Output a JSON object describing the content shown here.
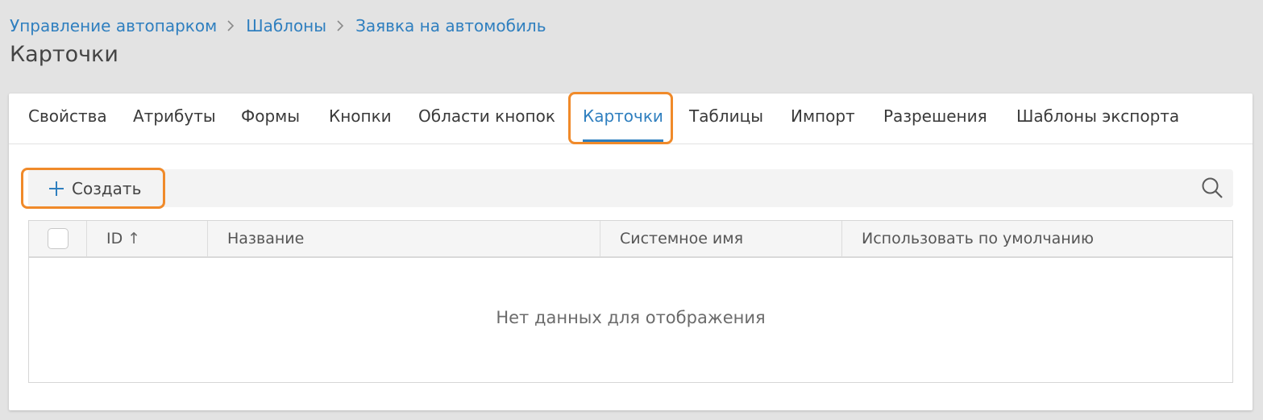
{
  "breadcrumb": {
    "items": [
      {
        "label": "Управление автопарком"
      },
      {
        "label": "Шаблоны"
      },
      {
        "label": "Заявка на автомобиль"
      }
    ]
  },
  "page": {
    "title": "Карточки"
  },
  "tabs": {
    "items": [
      {
        "label": "Свойства"
      },
      {
        "label": "Атрибуты"
      },
      {
        "label": "Формы"
      },
      {
        "label": "Кнопки"
      },
      {
        "label": "Области кнопок"
      },
      {
        "label": "Карточки"
      },
      {
        "label": "Таблицы"
      },
      {
        "label": "Импорт"
      },
      {
        "label": "Разрешения"
      },
      {
        "label": "Шаблоны экспорта"
      }
    ],
    "active": "Карточки"
  },
  "toolbar": {
    "create_label": "Создать",
    "create_icon": "plus-icon",
    "search_icon": "search-icon"
  },
  "table": {
    "columns": [
      {
        "label": "ID",
        "sort": "↑"
      },
      {
        "label": "Название"
      },
      {
        "label": "Системное имя"
      },
      {
        "label": "Использовать по умолчанию"
      }
    ],
    "empty_text": "Нет данных для отображения"
  },
  "colors": {
    "accent": "#2f7fbf",
    "highlight": "#f08a2a",
    "background": "#e3e3e3"
  }
}
